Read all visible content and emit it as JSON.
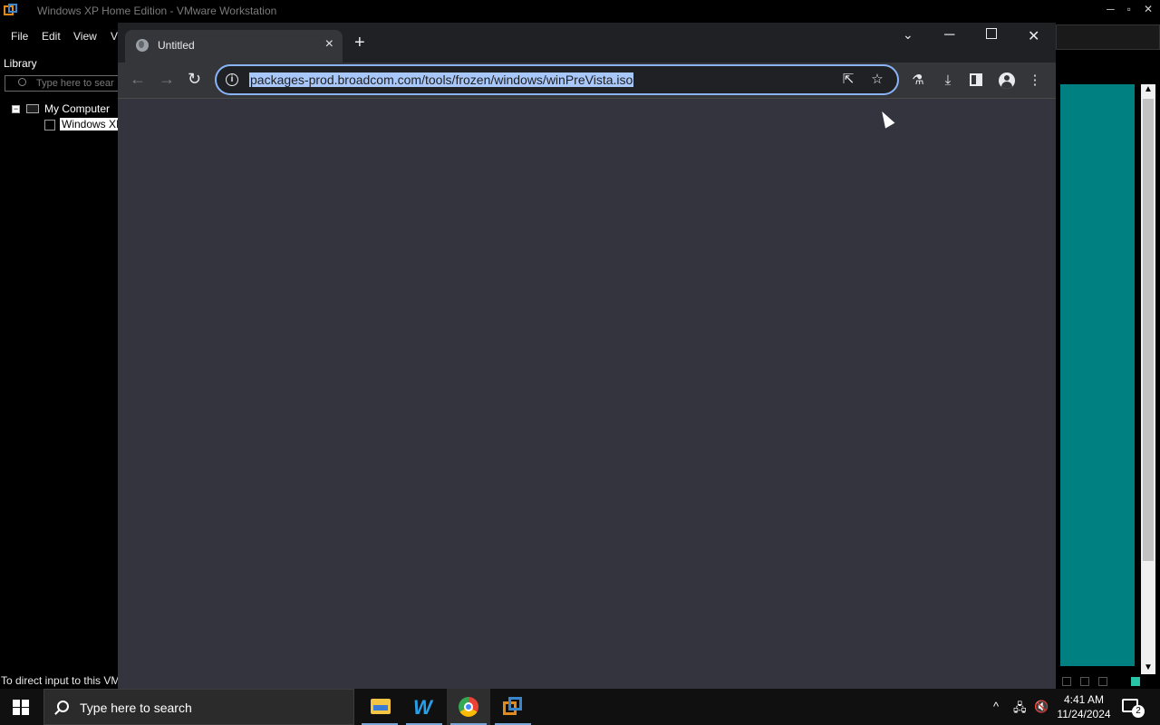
{
  "vmware": {
    "title": "Windows XP Home Edition - VMware Workstation",
    "menu": [
      "File",
      "Edit",
      "View",
      "V"
    ],
    "library_label": "Library",
    "search_placeholder": "Type here to sear",
    "tree": {
      "root": "My Computer",
      "child": "Windows XI"
    },
    "status_text": "To direct input to this VM",
    "teal_color": "#008080"
  },
  "chrome": {
    "tab_title": "Untitled",
    "url": "packages-prod.broadcom.com/tools/frozen/windows/winPreVista.iso",
    "icons": [
      "back-arrow",
      "forward-arrow",
      "reload",
      "site-info",
      "share",
      "bookmark-star",
      "labs-flask",
      "download",
      "side-panel",
      "profile",
      "menu-kebab"
    ],
    "accent": "#8ab4f8",
    "content_bg": "#34343f"
  },
  "taskbar": {
    "search_placeholder": "Type here to search",
    "apps": [
      "file-explorer",
      "word-app",
      "chrome",
      "vmware-workstation"
    ],
    "time": "4:41 AM",
    "date": "11/24/2024",
    "notification_count": "2"
  }
}
